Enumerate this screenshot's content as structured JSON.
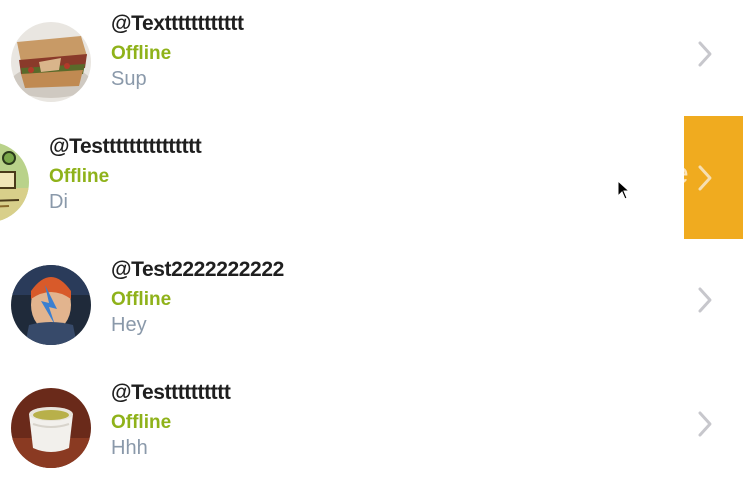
{
  "chats": [
    {
      "username": "@Textttttttttttt",
      "status": "Offline",
      "last_message": "Sup",
      "avatar": "sandwich-photo",
      "swiped": false
    },
    {
      "username": "@Testtttttttttttttt",
      "status": "Offline",
      "last_message": "Di",
      "avatar": "cartoon-illustration",
      "swiped": true
    },
    {
      "username": "@Test2222222222",
      "status": "Offline",
      "last_message": "Hey",
      "avatar": "bowie-mural-photo",
      "swiped": false
    },
    {
      "username": "@Testttttttttt",
      "status": "Offline",
      "last_message": "Hhh",
      "avatar": "tea-cup-photo",
      "swiped": false
    }
  ],
  "swipe_action": {
    "label": "e",
    "color": "#f0ab1f"
  },
  "colors": {
    "status": "#8fb21a",
    "message": "#8a99aa",
    "username": "#1f1f1f",
    "chevron": "#c7c7cc"
  },
  "icons": {
    "row_chevron": "chevron-right-icon",
    "cursor": "mouse-pointer-icon"
  }
}
